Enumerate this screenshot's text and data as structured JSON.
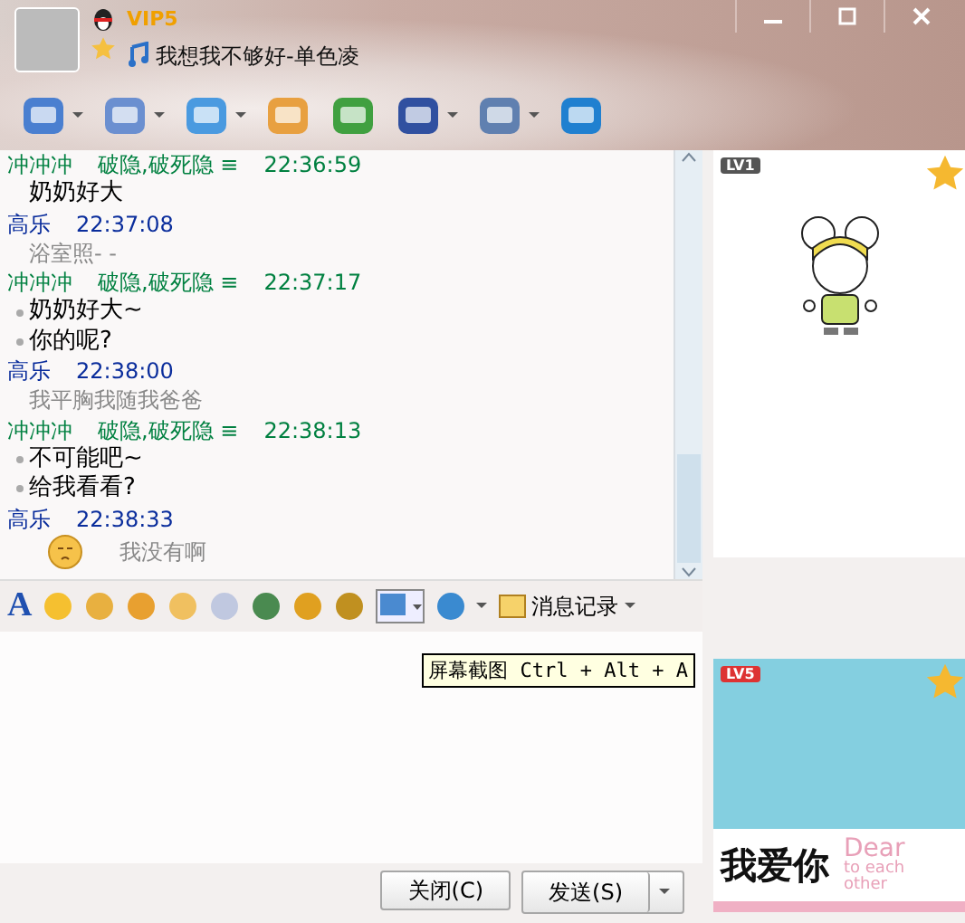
{
  "header": {
    "vip_badge": "VIP5",
    "signature": "我想我不够好-单色凌"
  },
  "messages": [
    {
      "kind": "friend",
      "sender": "冲冲冲",
      "tag": "破隐,破死隐 ≡",
      "time": "22:36:59",
      "lines": [
        {
          "text": "奶奶好大",
          "bulleted": false
        }
      ]
    },
    {
      "kind": "self",
      "sender": "高乐",
      "time": "22:37:08",
      "lines": [
        {
          "text": "浴室照- -",
          "bulleted": false
        }
      ]
    },
    {
      "kind": "friend",
      "sender": "冲冲冲",
      "tag": "破隐,破死隐 ≡",
      "time": "22:37:17",
      "lines": [
        {
          "text": "奶奶好大~",
          "bulleted": true
        },
        {
          "text": "你的呢?",
          "bulleted": true
        }
      ]
    },
    {
      "kind": "self",
      "sender": "高乐",
      "time": "22:38:00",
      "lines": [
        {
          "text": "我平胸我随我爸爸",
          "bulleted": false
        }
      ]
    },
    {
      "kind": "friend",
      "sender": "冲冲冲",
      "tag": "破隐,破死隐 ≡",
      "time": "22:38:13",
      "lines": [
        {
          "text": "不可能吧~",
          "bulleted": true
        },
        {
          "text": "给我看看?",
          "bulleted": true
        }
      ]
    },
    {
      "kind": "self",
      "sender": "高乐",
      "time": "22:38:33",
      "emoji": true,
      "lines": [
        {
          "text": "我没有啊",
          "bulleted": false
        }
      ]
    }
  ],
  "format_bar": {
    "font_button": "A",
    "history_label": "消息记录"
  },
  "tooltip": "屏幕截图 Ctrl + Alt + A",
  "buttons": [
    {
      "label": "关闭(C)"
    },
    {
      "label": "发送(S)"
    }
  ],
  "show_panels": [
    {
      "level": "LV1",
      "kind": "character"
    },
    {
      "level": "LV5",
      "kind": "love",
      "big_text": "我爱你",
      "small_texts": [
        "Dear",
        "to each",
        "other"
      ]
    }
  ]
}
